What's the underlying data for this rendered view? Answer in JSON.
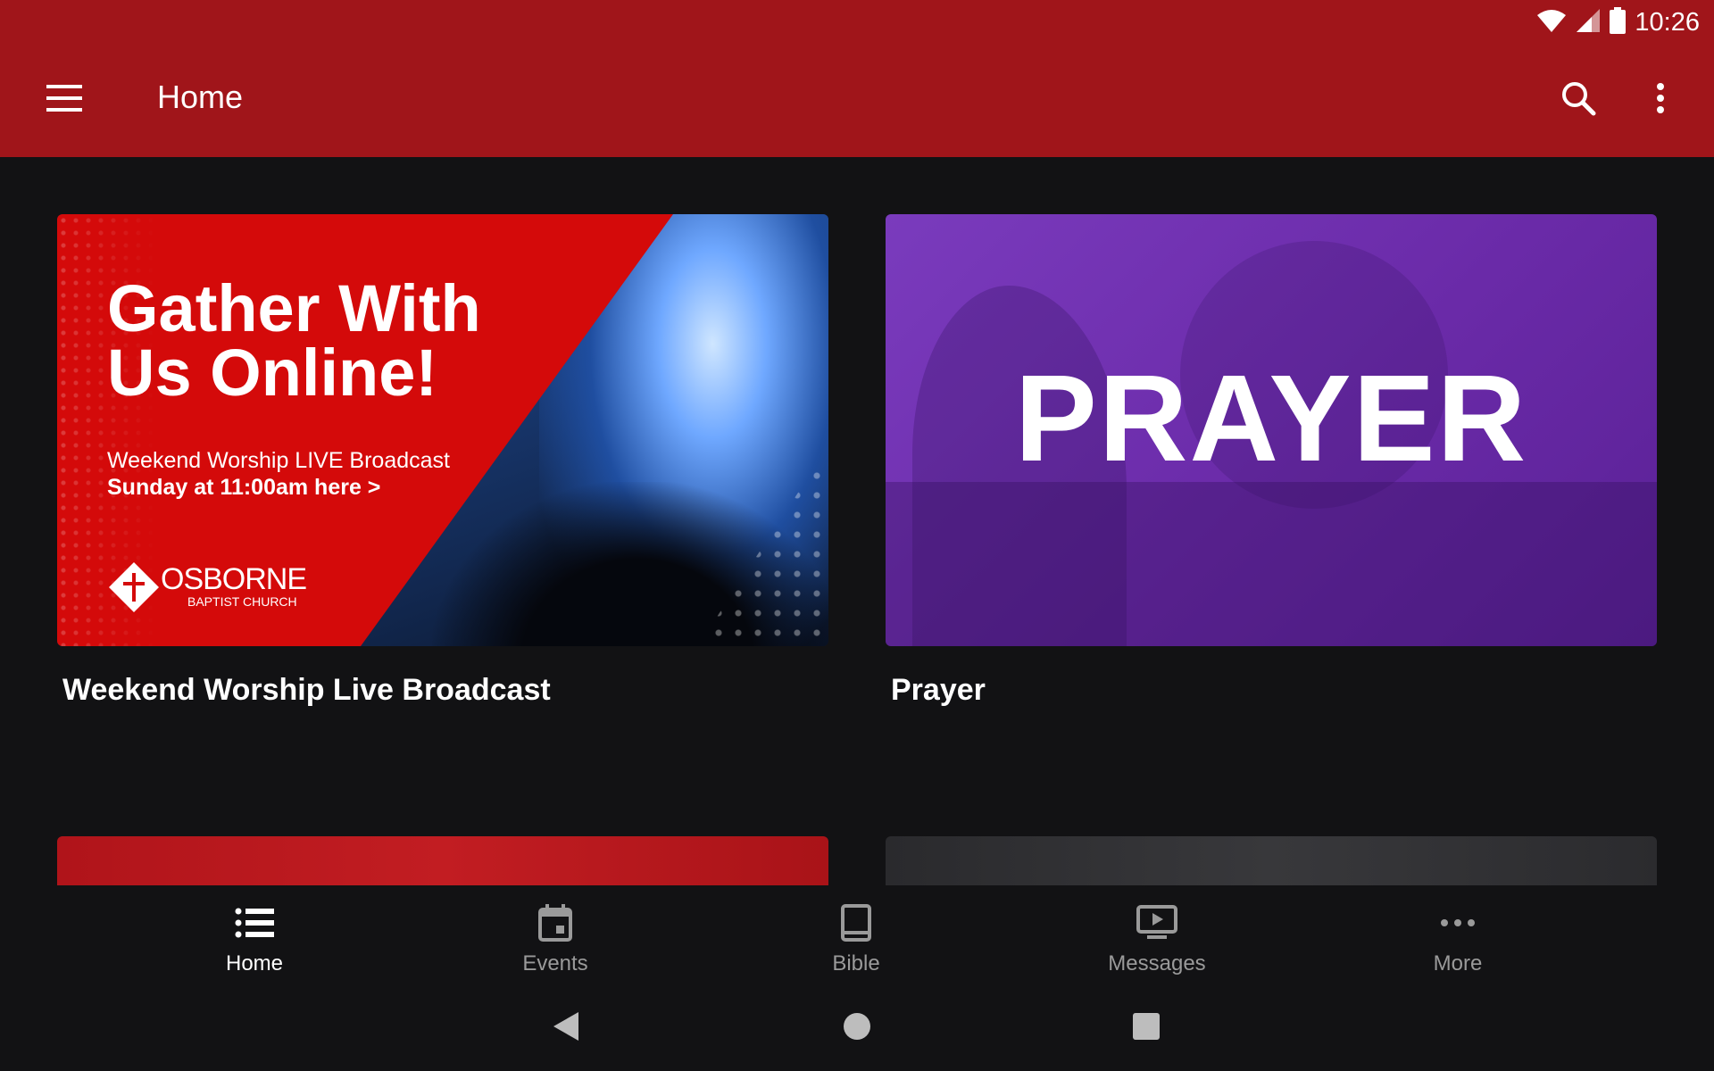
{
  "status": {
    "time": "10:26"
  },
  "toolbar": {
    "title": "Home"
  },
  "cards": [
    {
      "title": "Weekend Worship Live Broadcast",
      "banner": {
        "headline_line1": "Gather With",
        "headline_line2": "Us Online!",
        "subline1": "Weekend Worship LIVE Broadcast",
        "subline2": "Sunday at 11:00am here >",
        "logo_name": "OSBORNE",
        "logo_sub": "BAPTIST CHURCH"
      }
    },
    {
      "title": "Prayer",
      "banner": {
        "word": "PRAYER"
      }
    }
  ],
  "bottom_nav": {
    "items": [
      {
        "label": "Home",
        "icon": "list-icon",
        "active": true
      },
      {
        "label": "Events",
        "icon": "calendar-icon",
        "active": false
      },
      {
        "label": "Bible",
        "icon": "book-icon",
        "active": false
      },
      {
        "label": "Messages",
        "icon": "video-icon",
        "active": false
      },
      {
        "label": "More",
        "icon": "more-horizontal-icon",
        "active": false
      }
    ]
  },
  "colors": {
    "appbar": "#a0151a",
    "background": "#121214",
    "banner_red": "#d40a0a",
    "prayer_purple": "#7a3bbd",
    "nav_inactive": "#9a9a9a"
  }
}
